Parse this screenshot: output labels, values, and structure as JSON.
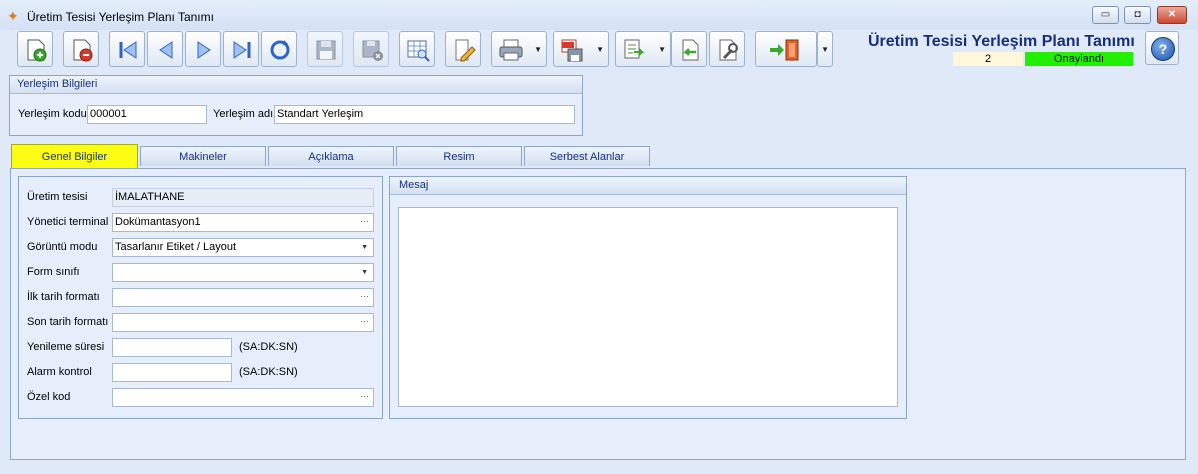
{
  "window": {
    "title": "Üretim Tesisi Yerleşim Planı Tanımı",
    "minimize": "▭",
    "restore": "◘",
    "close": "✕"
  },
  "toolbar": {
    "buttons": [
      "new-record-icon",
      "delete-record-icon",
      "first-record-icon",
      "previous-record-icon",
      "next-record-icon",
      "last-record-icon",
      "refresh-icon",
      "save-icon",
      "cancel-save-icon",
      "preview-grid-icon",
      "edit-icon",
      "print-icon",
      "pdf-export-icon",
      "export-icon",
      "import-icon",
      "settings-tools-icon",
      "exit-door-icon",
      "more-options-icon"
    ]
  },
  "header": {
    "form_title": "Üretim Tesisi Yerleşim Planı Tanımı",
    "record_number": "2",
    "status": "Onaylandı",
    "status_color": "#22f000"
  },
  "yerlesim": {
    "group_title": "Yerleşim Bilgileri",
    "code_label": "Yerleşim kodu",
    "code_value": "000001",
    "name_label": "Yerleşim adı",
    "name_value": "Standart Yerleşim"
  },
  "tabs": [
    {
      "label": "Genel Bilgiler",
      "active": true
    },
    {
      "label": "Makineler"
    },
    {
      "label": "Açıklama"
    },
    {
      "label": "Resim"
    },
    {
      "label": "Serbest Alanlar"
    }
  ],
  "genel": {
    "uretim_tesisi_label": "Üretim tesisi",
    "uretim_tesisi_value": "İMALATHANE",
    "yonetici_terminal_label": "Yönetici terminal",
    "yonetici_terminal_value": "Dokümantasyon1",
    "goruntu_modu_label": "Görüntü modu",
    "goruntu_modu_value": "Tasarlanır Etiket / Layout",
    "form_sinifi_label": "Form sınıfı",
    "form_sinifi_value": "",
    "ilk_tarih_label": "İlk tarih formatı",
    "ilk_tarih_value": "",
    "son_tarih_label": "Son tarih formatı",
    "son_tarih_value": "",
    "yenileme_label": "Yenileme süresi",
    "yenileme_value": "",
    "yenileme_unit": "(SA:DK:SN)",
    "alarm_label": "Alarm kontrol",
    "alarm_value": "",
    "alarm_unit": "(SA:DK:SN)",
    "ozel_kod_label": "Özel kod",
    "ozel_kod_value": ""
  },
  "mesaj": {
    "title": "Mesaj",
    "value": ""
  },
  "glyphs": {
    "ellipsis": "···",
    "dropdown": "▼",
    "help": "?",
    "butterfly": "✦"
  }
}
